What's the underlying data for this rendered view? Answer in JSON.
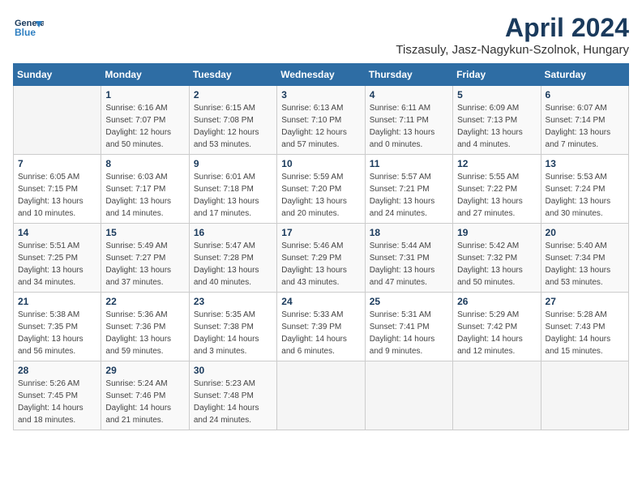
{
  "logo": {
    "line1": "General",
    "line2": "Blue"
  },
  "title": "April 2024",
  "subtitle": "Tiszasuly, Jasz-Nagykun-Szolnok, Hungary",
  "weekdays": [
    "Sunday",
    "Monday",
    "Tuesday",
    "Wednesday",
    "Thursday",
    "Friday",
    "Saturday"
  ],
  "weeks": [
    [
      {
        "day": null
      },
      {
        "day": "1",
        "sunrise": "6:16 AM",
        "sunset": "7:07 PM",
        "daylight": "12 hours and 50 minutes."
      },
      {
        "day": "2",
        "sunrise": "6:15 AM",
        "sunset": "7:08 PM",
        "daylight": "12 hours and 53 minutes."
      },
      {
        "day": "3",
        "sunrise": "6:13 AM",
        "sunset": "7:10 PM",
        "daylight": "12 hours and 57 minutes."
      },
      {
        "day": "4",
        "sunrise": "6:11 AM",
        "sunset": "7:11 PM",
        "daylight": "13 hours and 0 minutes."
      },
      {
        "day": "5",
        "sunrise": "6:09 AM",
        "sunset": "7:13 PM",
        "daylight": "13 hours and 4 minutes."
      },
      {
        "day": "6",
        "sunrise": "6:07 AM",
        "sunset": "7:14 PM",
        "daylight": "13 hours and 7 minutes."
      }
    ],
    [
      {
        "day": "7",
        "sunrise": "6:05 AM",
        "sunset": "7:15 PM",
        "daylight": "13 hours and 10 minutes."
      },
      {
        "day": "8",
        "sunrise": "6:03 AM",
        "sunset": "7:17 PM",
        "daylight": "13 hours and 14 minutes."
      },
      {
        "day": "9",
        "sunrise": "6:01 AM",
        "sunset": "7:18 PM",
        "daylight": "13 hours and 17 minutes."
      },
      {
        "day": "10",
        "sunrise": "5:59 AM",
        "sunset": "7:20 PM",
        "daylight": "13 hours and 20 minutes."
      },
      {
        "day": "11",
        "sunrise": "5:57 AM",
        "sunset": "7:21 PM",
        "daylight": "13 hours and 24 minutes."
      },
      {
        "day": "12",
        "sunrise": "5:55 AM",
        "sunset": "7:22 PM",
        "daylight": "13 hours and 27 minutes."
      },
      {
        "day": "13",
        "sunrise": "5:53 AM",
        "sunset": "7:24 PM",
        "daylight": "13 hours and 30 minutes."
      }
    ],
    [
      {
        "day": "14",
        "sunrise": "5:51 AM",
        "sunset": "7:25 PM",
        "daylight": "13 hours and 34 minutes."
      },
      {
        "day": "15",
        "sunrise": "5:49 AM",
        "sunset": "7:27 PM",
        "daylight": "13 hours and 37 minutes."
      },
      {
        "day": "16",
        "sunrise": "5:47 AM",
        "sunset": "7:28 PM",
        "daylight": "13 hours and 40 minutes."
      },
      {
        "day": "17",
        "sunrise": "5:46 AM",
        "sunset": "7:29 PM",
        "daylight": "13 hours and 43 minutes."
      },
      {
        "day": "18",
        "sunrise": "5:44 AM",
        "sunset": "7:31 PM",
        "daylight": "13 hours and 47 minutes."
      },
      {
        "day": "19",
        "sunrise": "5:42 AM",
        "sunset": "7:32 PM",
        "daylight": "13 hours and 50 minutes."
      },
      {
        "day": "20",
        "sunrise": "5:40 AM",
        "sunset": "7:34 PM",
        "daylight": "13 hours and 53 minutes."
      }
    ],
    [
      {
        "day": "21",
        "sunrise": "5:38 AM",
        "sunset": "7:35 PM",
        "daylight": "13 hours and 56 minutes."
      },
      {
        "day": "22",
        "sunrise": "5:36 AM",
        "sunset": "7:36 PM",
        "daylight": "13 hours and 59 minutes."
      },
      {
        "day": "23",
        "sunrise": "5:35 AM",
        "sunset": "7:38 PM",
        "daylight": "14 hours and 3 minutes."
      },
      {
        "day": "24",
        "sunrise": "5:33 AM",
        "sunset": "7:39 PM",
        "daylight": "14 hours and 6 minutes."
      },
      {
        "day": "25",
        "sunrise": "5:31 AM",
        "sunset": "7:41 PM",
        "daylight": "14 hours and 9 minutes."
      },
      {
        "day": "26",
        "sunrise": "5:29 AM",
        "sunset": "7:42 PM",
        "daylight": "14 hours and 12 minutes."
      },
      {
        "day": "27",
        "sunrise": "5:28 AM",
        "sunset": "7:43 PM",
        "daylight": "14 hours and 15 minutes."
      }
    ],
    [
      {
        "day": "28",
        "sunrise": "5:26 AM",
        "sunset": "7:45 PM",
        "daylight": "14 hours and 18 minutes."
      },
      {
        "day": "29",
        "sunrise": "5:24 AM",
        "sunset": "7:46 PM",
        "daylight": "14 hours and 21 minutes."
      },
      {
        "day": "30",
        "sunrise": "5:23 AM",
        "sunset": "7:48 PM",
        "daylight": "14 hours and 24 minutes."
      },
      {
        "day": null
      },
      {
        "day": null
      },
      {
        "day": null
      },
      {
        "day": null
      }
    ]
  ]
}
